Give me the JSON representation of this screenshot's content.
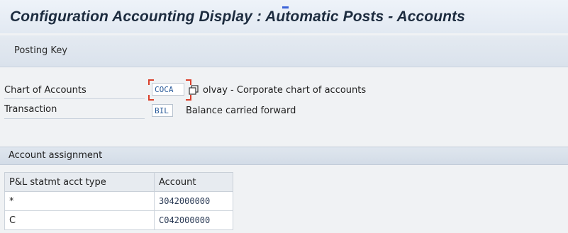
{
  "window": {
    "title": "Configuration Accounting Display : Automatic Posts - Accounts"
  },
  "toolbar": {
    "posting_key_label": "Posting Key"
  },
  "header_fields": {
    "chart_of_accounts": {
      "label": "Chart of Accounts",
      "value": "COCA",
      "description": "olvay - Corporate chart of accounts"
    },
    "transaction": {
      "label": "Transaction",
      "value": "BIL",
      "description": "Balance carried forward"
    }
  },
  "account_assignment": {
    "section_title": "Account assignment",
    "columns": [
      "P&L statmt acct type",
      "Account"
    ],
    "rows": [
      {
        "type": "*",
        "account": "3042000000"
      },
      {
        "type": "C",
        "account": "C042000000"
      }
    ]
  },
  "colors": {
    "title_text": "#1d2c3f",
    "field_focus": "#d9402b",
    "field_value": "#2a5b9a"
  },
  "icons": {
    "value_help": "possible-entries-icon"
  }
}
